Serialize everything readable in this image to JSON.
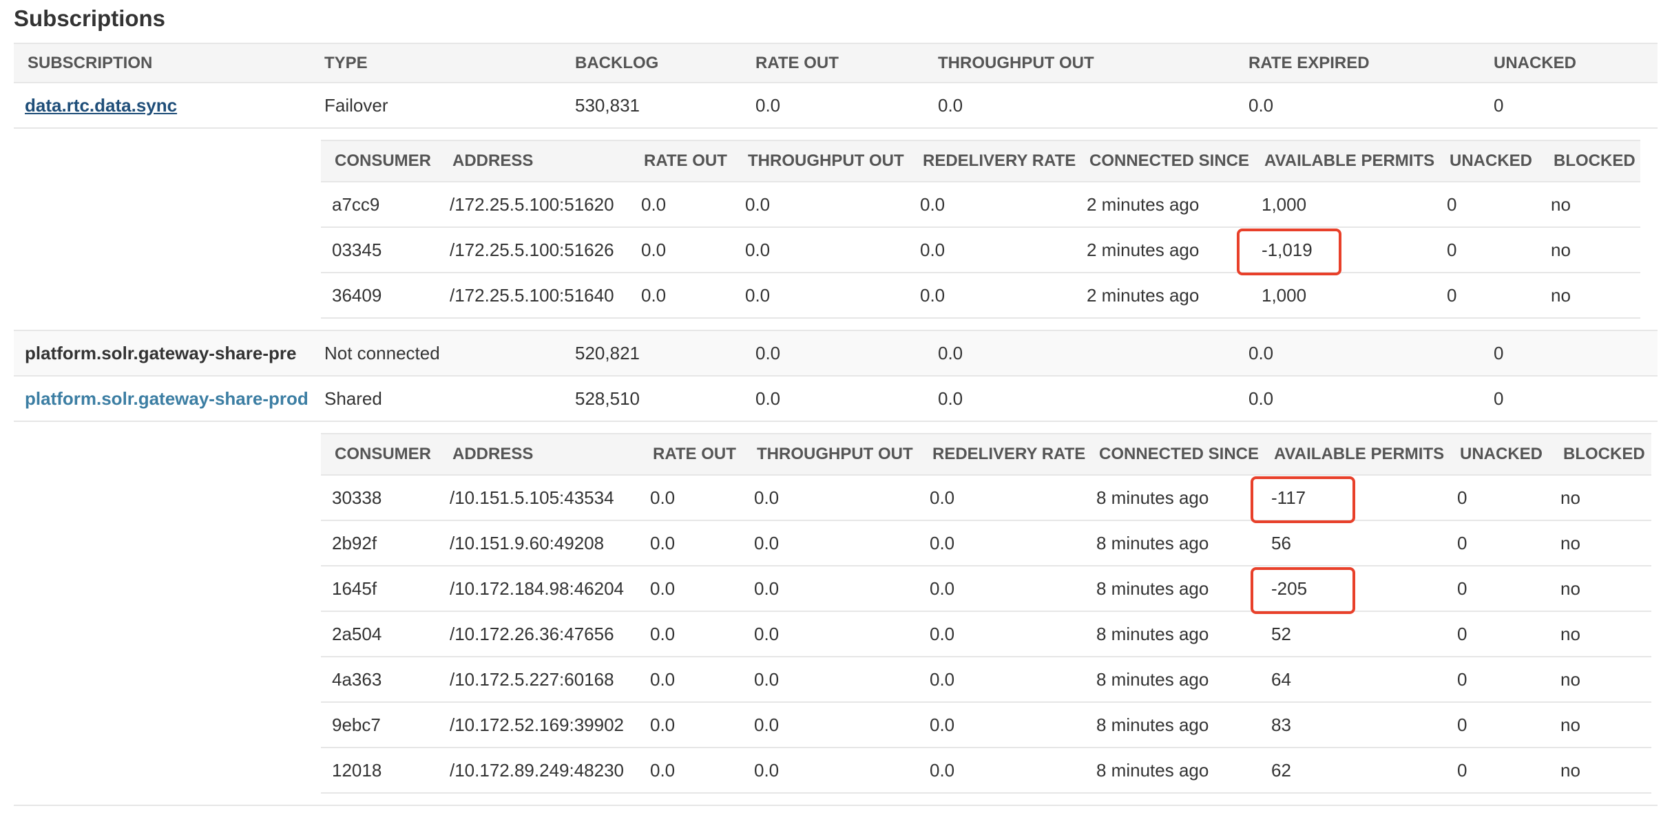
{
  "page": {
    "title": "Subscriptions"
  },
  "subscriptions_table": {
    "headers": [
      "SUBSCRIPTION",
      "TYPE",
      "BACKLOG",
      "RATE OUT",
      "THROUGHPUT OUT",
      "RATE EXPIRED",
      "UNACKED"
    ],
    "rows": [
      {
        "name": "data.rtc.data.sync",
        "type": "Failover",
        "backlog": "530,831",
        "rate_out": "0.0",
        "throughput_out": "0.0",
        "rate_expired": "0.0",
        "unacked": "0"
      },
      {
        "name": "platform.solr.gateway-share-pre",
        "type": "Not connected",
        "backlog": "520,821",
        "rate_out": "0.0",
        "throughput_out": "0.0",
        "rate_expired": "0.0",
        "unacked": "0"
      },
      {
        "name": "platform.solr.gateway-share-prod",
        "type": "Shared",
        "backlog": "528,510",
        "rate_out": "0.0",
        "throughput_out": "0.0",
        "rate_expired": "0.0",
        "unacked": "0"
      }
    ]
  },
  "consumers_table_headers": [
    "CONSUMER",
    "ADDRESS",
    "RATE OUT",
    "THROUGHPUT OUT",
    "REDELIVERY RATE",
    "CONNECTED SINCE",
    "AVAILABLE PERMITS",
    "UNACKED",
    "BLOCKED"
  ],
  "consumers_sub1": [
    {
      "consumer": "a7cc9",
      "address": "/172.25.5.100:51620",
      "rate_out": "0.0",
      "throughput_out": "0.0",
      "redelivery_rate": "0.0",
      "connected_since": "2 minutes ago",
      "available_permits": "1,000",
      "unacked": "0",
      "blocked": "no",
      "highlighted": false
    },
    {
      "consumer": "03345",
      "address": "/172.25.5.100:51626",
      "rate_out": "0.0",
      "throughput_out": "0.0",
      "redelivery_rate": "0.0",
      "connected_since": "2 minutes ago",
      "available_permits": "-1,019",
      "unacked": "0",
      "blocked": "no",
      "highlighted": true
    },
    {
      "consumer": "36409",
      "address": "/172.25.5.100:51640",
      "rate_out": "0.0",
      "throughput_out": "0.0",
      "redelivery_rate": "0.0",
      "connected_since": "2 minutes ago",
      "available_permits": "1,000",
      "unacked": "0",
      "blocked": "no",
      "highlighted": false
    }
  ],
  "consumers_sub3": [
    {
      "consumer": "30338",
      "address": "/10.151.5.105:43534",
      "rate_out": "0.0",
      "throughput_out": "0.0",
      "redelivery_rate": "0.0",
      "connected_since": "8 minutes ago",
      "available_permits": "-117",
      "unacked": "0",
      "blocked": "no",
      "highlighted": true
    },
    {
      "consumer": "2b92f",
      "address": "/10.151.9.60:49208",
      "rate_out": "0.0",
      "throughput_out": "0.0",
      "redelivery_rate": "0.0",
      "connected_since": "8 minutes ago",
      "available_permits": "56",
      "unacked": "0",
      "blocked": "no",
      "highlighted": false
    },
    {
      "consumer": "1645f",
      "address": "/10.172.184.98:46204",
      "rate_out": "0.0",
      "throughput_out": "0.0",
      "redelivery_rate": "0.0",
      "connected_since": "8 minutes ago",
      "available_permits": "-205",
      "unacked": "0",
      "blocked": "no",
      "highlighted": true
    },
    {
      "consumer": "2a504",
      "address": "/10.172.26.36:47656",
      "rate_out": "0.0",
      "throughput_out": "0.0",
      "redelivery_rate": "0.0",
      "connected_since": "8 minutes ago",
      "available_permits": "52",
      "unacked": "0",
      "blocked": "no",
      "highlighted": false
    },
    {
      "consumer": "4a363",
      "address": "/10.172.5.227:60168",
      "rate_out": "0.0",
      "throughput_out": "0.0",
      "redelivery_rate": "0.0",
      "connected_since": "8 minutes ago",
      "available_permits": "64",
      "unacked": "0",
      "blocked": "no",
      "highlighted": false
    },
    {
      "consumer": "9ebc7",
      "address": "/10.172.52.169:39902",
      "rate_out": "0.0",
      "throughput_out": "0.0",
      "redelivery_rate": "0.0",
      "connected_since": "8 minutes ago",
      "available_permits": "83",
      "unacked": "0",
      "blocked": "no",
      "highlighted": false
    },
    {
      "consumer": "12018",
      "address": "/10.172.89.249:48230",
      "rate_out": "0.0",
      "throughput_out": "0.0",
      "redelivery_rate": "0.0",
      "connected_since": "8 minutes ago",
      "available_permits": "62",
      "unacked": "0",
      "blocked": "no",
      "highlighted": false
    }
  ],
  "colors": {
    "highlight_box": "#e8402a",
    "link_dark": "#1f4e79",
    "link_light": "#3c7ea3",
    "header_bg": "#f5f5f5"
  }
}
